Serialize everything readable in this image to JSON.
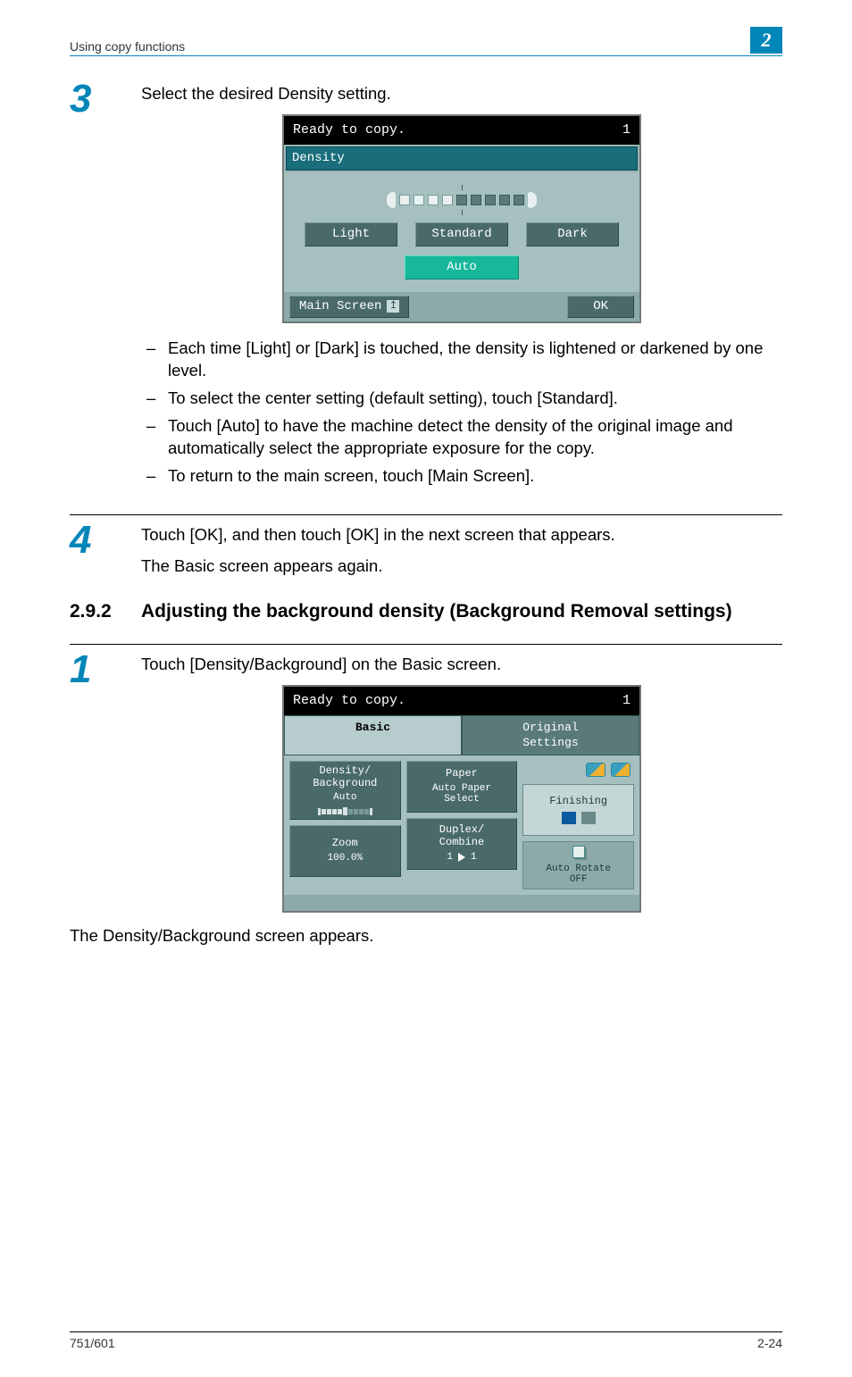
{
  "header": {
    "running": "Using copy functions",
    "chapnum": "2"
  },
  "footer": {
    "model": "751/601",
    "pageno": "2-24"
  },
  "step3": {
    "num": "3",
    "text": "Select the desired Density setting.",
    "bullets": [
      "Each time [Light] or [Dark] is touched, the density is lightened or darkened by one level.",
      "To select the center setting (default setting), touch [Standard].",
      "Touch [Auto] to have the machine detect the density of the original image and automatically select the appropriate exposure for the copy.",
      "To return to the main screen, touch [Main Screen]."
    ]
  },
  "step4": {
    "num": "4",
    "line1": "Touch [OK], and then touch [OK] in the next screen that appears.",
    "line2": "The Basic screen appears again."
  },
  "section": {
    "no": "2.9.2",
    "title": "Adjusting the background density (Background Removal settings)"
  },
  "step1b": {
    "num": "1",
    "text": "Touch [Density/Background] on the Basic screen.",
    "after": "The Density/Background screen appears."
  },
  "dev1": {
    "status": "Ready to copy.",
    "count": "1",
    "title": "Density",
    "light": "Light",
    "standard": "Standard",
    "dark": "Dark",
    "auto": "Auto",
    "mainscreen": "Main Screen",
    "ok": "OK"
  },
  "dev2": {
    "status": "Ready to copy.",
    "count": "1",
    "tab_basic": "Basic",
    "tab_original": "Original\nSettings",
    "density_bg": "Density/\nBackground",
    "density_bg_val": "Auto",
    "paper": "Paper",
    "paper_val": "Auto Paper\nSelect",
    "zoom": "Zoom",
    "zoom_val": "100.0%",
    "duplex": "Duplex/\nCombine",
    "duplex_from": "1",
    "duplex_to": "1",
    "finishing": "Finishing",
    "autorotate": "Auto Rotate\nOFF"
  }
}
